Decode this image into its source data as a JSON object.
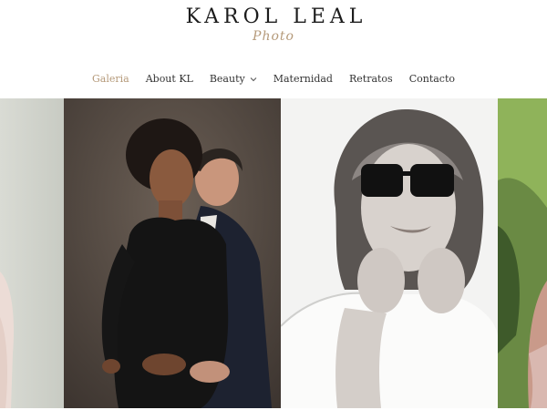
{
  "brand": {
    "name": "KAROL LEAL",
    "tagline": "Photo"
  },
  "nav": {
    "items": [
      {
        "label": "Galeria",
        "active": true
      },
      {
        "label": "About KL"
      },
      {
        "label": "Beauty",
        "has_dropdown": true
      },
      {
        "label": "Maternidad"
      },
      {
        "label": "Retratos"
      },
      {
        "label": "Contacto"
      }
    ]
  },
  "colors": {
    "accent": "#b59a7a",
    "nav_text": "#333333",
    "logo_text": "#1c1c1c"
  },
  "gallery": {
    "photos": [
      {
        "name": "cropped-portrait-left"
      },
      {
        "name": "maternity-couple-portrait"
      },
      {
        "name": "woman-sunglasses-portrait"
      },
      {
        "name": "cropped-portrait-right"
      }
    ]
  }
}
